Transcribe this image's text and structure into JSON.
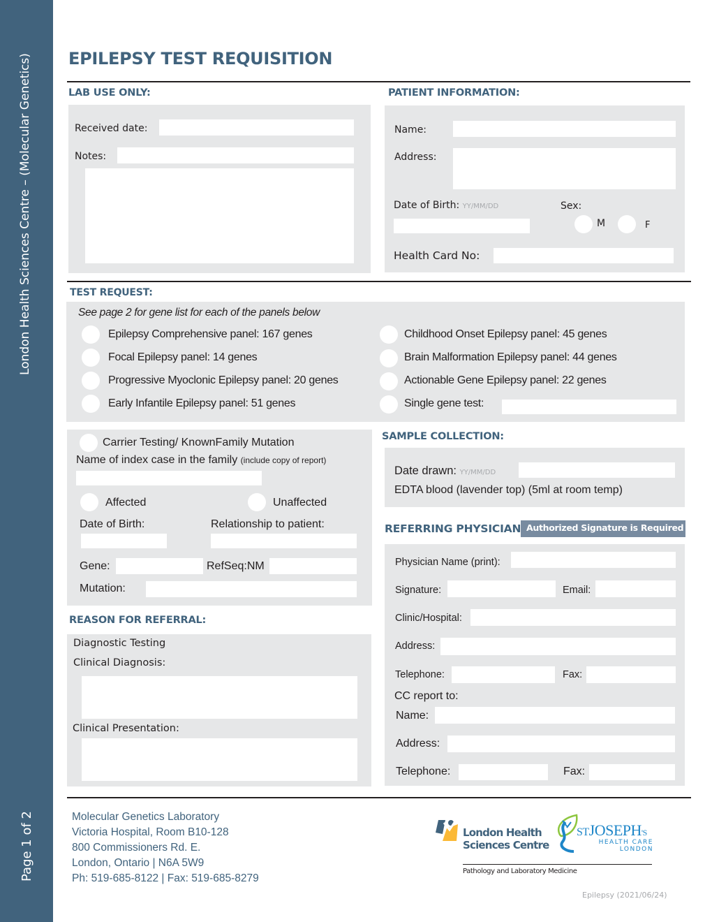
{
  "sidebar": {
    "org_label": "London Health Sciences Centre – (Molecular Genetics)",
    "page_label": "Page 1 of 2"
  },
  "header": {
    "title": "EPILEPSY TEST REQUISITION"
  },
  "lab_use": {
    "heading": "LAB USE ONLY:",
    "received_date_label": "Received date:",
    "received_date_value": "",
    "notes_label": "Notes:",
    "notes_value": ""
  },
  "patient": {
    "heading": "PATIENT INFORMATION:",
    "name_label": "Name:",
    "address_label": "Address:",
    "dob_label": "Date of Birth:",
    "dob_hint": "YY/MM/DD",
    "sex_label": "Sex:",
    "sex_options": [
      "M",
      "F"
    ],
    "health_card_label": "Health Card No:"
  },
  "test_request": {
    "heading": "TEST REQUEST:",
    "note": "See page 2 for gene list for each of the panels below",
    "options_left": [
      "Epilepsy Comprehensive panel: 167 genes",
      "Focal Epilepsy panel: 14 genes",
      "Progressive Myoclonic Epilepsy panel: 20 genes",
      "Early Infantile Epilepsy panel: 51 genes"
    ],
    "options_right": [
      "Childhood Onset Epilepsy panel: 45 genes",
      "Brain Malformation Epilepsy panel: 44 genes",
      "Actionable Gene Epilepsy panel: 22 genes",
      "Single gene test:"
    ]
  },
  "carrier": {
    "option_label": "Carrier Testing/ KnownFamily Mutation",
    "index_case_label": "Name of index case in the family",
    "index_case_hint": "(include copy of report)",
    "affected_label": "Affected",
    "unaffected_label": "Unaffected",
    "dob_label": "Date of Birth:",
    "relationship_label": "Relationship to patient:",
    "gene_label": "Gene:",
    "refseq_label": "RefSeq:NM",
    "mutation_label": "Mutation:"
  },
  "referral": {
    "heading": "REASON FOR REFERRAL:",
    "diagnostic_label": "Diagnostic Testing",
    "clinical_diagnosis_label": "Clinical Diagnosis:",
    "clinical_presentation_label": "Clinical Presentation:"
  },
  "sample": {
    "heading": "SAMPLE COLLECTION:",
    "date_drawn_label": "Date drawn:",
    "date_drawn_hint": "YY/MM/DD",
    "specimen_note": "EDTA blood (lavender top) (5ml at room temp)"
  },
  "physician": {
    "heading": "REFERRING PHYSICIAN:",
    "badge": "Authorized Signature is Required",
    "name_label": "Physician Name (print):",
    "signature_label": "Signature:",
    "email_label": "Email:",
    "clinic_label": "Clinic/Hospital:",
    "address_label": "Address:",
    "telephone_label": "Telephone:",
    "fax_label": "Fax:",
    "cc_label": "CC report to:",
    "cc_name_label": "Name:",
    "cc_address_label": "Address:",
    "cc_telephone_label": "Telephone:",
    "cc_fax_label": "Fax:"
  },
  "footer": {
    "address_lines": [
      "Molecular Genetics Laboratory",
      "Victoria Hospital, Room B10-128",
      "800 Commissioners Rd. E.",
      "London, Ontario | N6A 5W9",
      "Ph: 519-685-8122 | Fax: 519-685-8279"
    ],
    "lhsc_logo_line1": "London Health",
    "lhsc_logo_line2": "Sciences Centre",
    "sjhc_logo_main": "JOSEPH",
    "sjhc_logo_st": "ST",
    "sjhc_logo_s": "'S",
    "sjhc_logo_line2": "HEALTH CARE",
    "sjhc_logo_line3": "LONDON",
    "dept": "Pathology and Laboratory Medicine",
    "version": "Epilepsy (2021/06/24)"
  },
  "colors": {
    "brand_blue": "#41637d",
    "panel_gray": "#e6e7e8",
    "badge_gray": "#788ba0",
    "lhsc_yellow": "#fbb936",
    "sjhc_green": "#8dc63f",
    "sjhc_blue": "#1e86c8"
  }
}
